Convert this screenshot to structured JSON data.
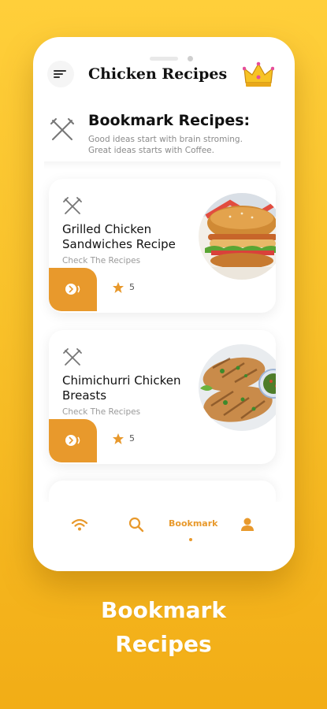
{
  "header": {
    "app_title": "Chicken Recipes",
    "menu_icon": "menu-icon",
    "crown_icon": "crown-icon"
  },
  "bookmark_section": {
    "title": "Bookmark Recipes:",
    "subtitle_line1": "Good ideas start with brain stroming.",
    "subtitle_line2": "Great ideas starts with Coffee."
  },
  "recipes": [
    {
      "name": "Grilled Chicken Sandwiches Recipe",
      "link_label": "Check The Recipes",
      "rating": "5",
      "image": "grilled-chicken-sandwich"
    },
    {
      "name": "Chimichurri Chicken Breasts",
      "link_label": "Check The Recipes",
      "rating": "5",
      "image": "chimichurri-chicken"
    }
  ],
  "bottom_nav": {
    "items": [
      "wifi-icon",
      "search-icon",
      "Bookmark",
      "user-icon"
    ],
    "active": "Bookmark"
  },
  "caption": {
    "line1": "Bookmark",
    "line2": "Recipes"
  },
  "colors": {
    "accent": "#e8992c",
    "background_top": "#ffcf3a",
    "background_bottom": "#f2ad16"
  }
}
